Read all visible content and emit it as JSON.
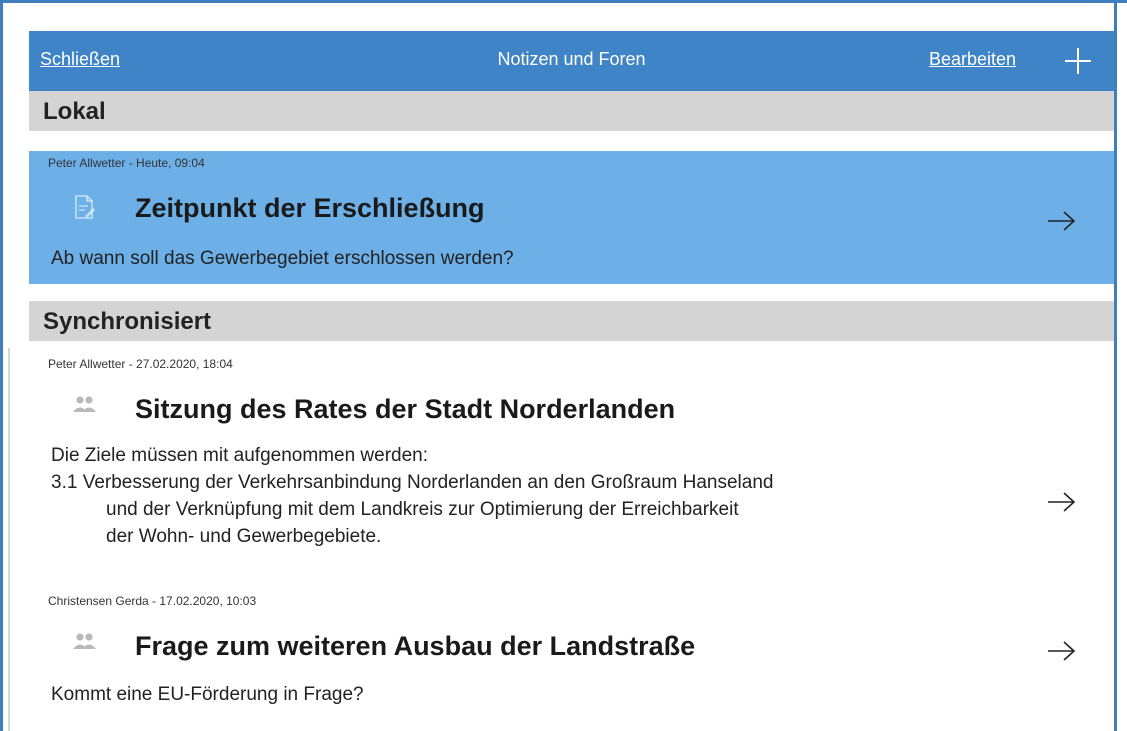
{
  "header": {
    "close_label": "Schließen",
    "title": "Notizen und Foren",
    "edit_label": "Bearbeiten"
  },
  "sections": [
    {
      "title": "Lokal"
    },
    {
      "title": "Synchronisiert"
    }
  ],
  "items": [
    {
      "meta": "Peter Allwetter -  Heute, 09:04",
      "icon": "note-icon",
      "title": "Zeitpunkt der Erschließung",
      "body": [
        "Ab wann soll das Gewerbegebiet erschlossen werden?"
      ],
      "selected": true
    },
    {
      "meta": "Peter Allwetter -  27.02.2020, 18:04",
      "icon": "group-icon",
      "title": "Sitzung des Rates der Stadt Norderlanden",
      "body": [
        "Die Ziele müssen mit aufgenommen werden:",
        "3.1 Verbesserung der Verkehrsanbindung Norderlanden an den Großraum Hanseland",
        "und der Verknüpfung mit dem Landkreis zur Optimierung der Erreichbarkeit",
        "der Wohn- und Gewerbegebiete."
      ],
      "selected": false
    },
    {
      "meta": "Christensen Gerda -  17.02.2020, 10:03",
      "icon": "group-icon",
      "title": "Frage zum weiteren Ausbau der Landstraße",
      "body": [
        "Kommt eine EU-Förderung in Frage?"
      ],
      "selected": false
    }
  ],
  "colors": {
    "accent": "#3f84c6",
    "selected_row": "#6db0e8",
    "section_bg": "#d4d4d4"
  }
}
